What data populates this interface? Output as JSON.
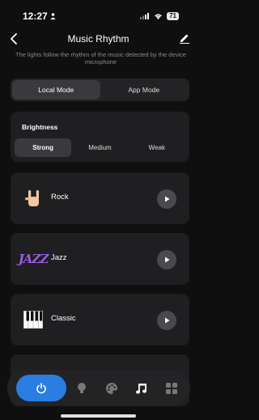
{
  "status_bar": {
    "time": "12:27",
    "battery": "71"
  },
  "nav": {
    "title": "Music Rhythm"
  },
  "description": "The lights follow the rhythm of the music detected by the device microphone",
  "modes": [
    {
      "label": "Local Mode",
      "active": true
    },
    {
      "label": "App Mode",
      "active": false
    }
  ],
  "brightness": {
    "label": "Brightness",
    "options": [
      {
        "label": "Strong",
        "active": true
      },
      {
        "label": "Medium",
        "active": false
      },
      {
        "label": "Weak",
        "active": false
      }
    ]
  },
  "genres": [
    {
      "label": "Rock",
      "icon": "rock-hand-icon"
    },
    {
      "label": "Jazz",
      "icon": "jazz-icon",
      "icon_text": "JAZZ"
    },
    {
      "label": "Classic",
      "icon": "piano-icon"
    }
  ],
  "bottom_nav": {
    "items": [
      "power-icon",
      "bulb-icon",
      "palette-icon",
      "music-note-icon",
      "grid-icon"
    ],
    "active": "music-note-icon"
  },
  "colors": {
    "accent": "#2a7de1",
    "jazz": "#9b5de5",
    "background": "#0f0f10",
    "card": "#1f1f21"
  }
}
